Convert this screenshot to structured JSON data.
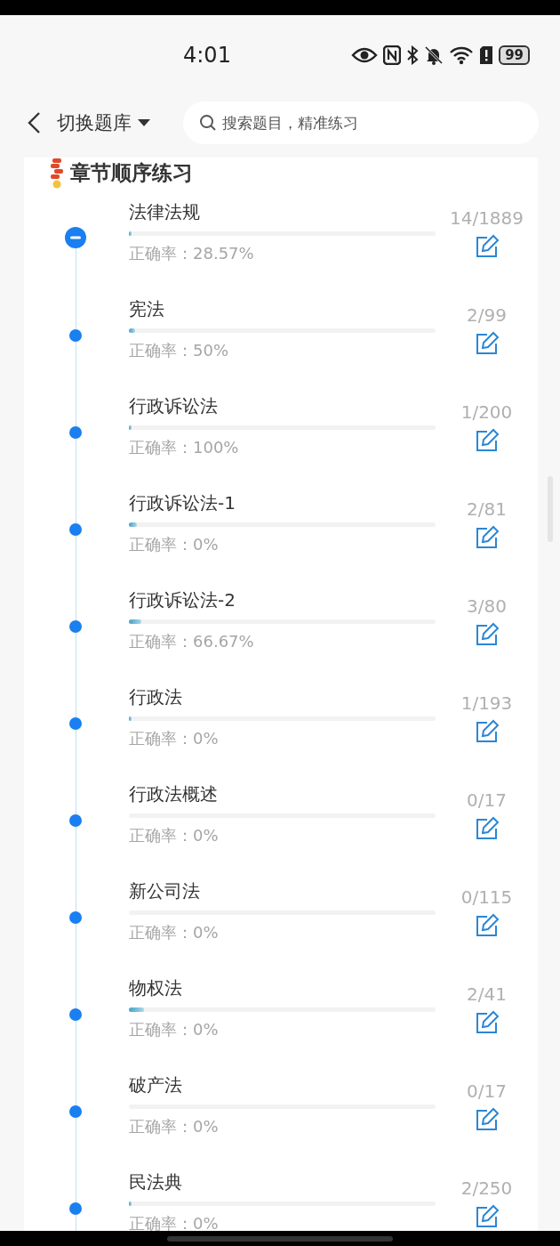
{
  "status_bar": {
    "time": "4:01",
    "battery": "99"
  },
  "header": {
    "title": "切换题库",
    "search": {
      "placeholder": "搜索题目，精准练习"
    }
  },
  "section": {
    "title": "章节顺序练习"
  },
  "chapters": [
    {
      "name": "法律法规",
      "expanded": true,
      "level": 0.01,
      "accuracy": "正确率：28.57%",
      "count": "14/1889"
    },
    {
      "name": "宪法",
      "expanded": false,
      "level": 0.02,
      "accuracy": "正确率：50%",
      "count": "2/99"
    },
    {
      "name": "行政诉讼法",
      "expanded": false,
      "level": 0.008,
      "accuracy": "正确率：100%",
      "count": "1/200"
    },
    {
      "name": "行政诉讼法-1",
      "expanded": false,
      "level": 0.025,
      "accuracy": "正确率：0%",
      "count": "2/81"
    },
    {
      "name": "行政诉讼法-2",
      "expanded": false,
      "level": 0.04,
      "accuracy": "正确率：66.67%",
      "count": "3/80"
    },
    {
      "name": "行政法",
      "expanded": false,
      "level": 0.006,
      "accuracy": "正确率：0%",
      "count": "1/193"
    },
    {
      "name": "行政法概述",
      "expanded": false,
      "level": 0,
      "accuracy": "正确率：0%",
      "count": "0/17"
    },
    {
      "name": "新公司法",
      "expanded": false,
      "level": 0,
      "accuracy": "正确率：0%",
      "count": "0/115"
    },
    {
      "name": "物权法",
      "expanded": false,
      "level": 0.05,
      "accuracy": "正确率：0%",
      "count": "2/41"
    },
    {
      "name": "破产法",
      "expanded": false,
      "level": 0,
      "accuracy": "正确率：0%",
      "count": "0/17"
    },
    {
      "name": "民法典",
      "expanded": false,
      "level": 0.008,
      "accuracy": "正确率：0%",
      "count": "2/250"
    }
  ]
}
